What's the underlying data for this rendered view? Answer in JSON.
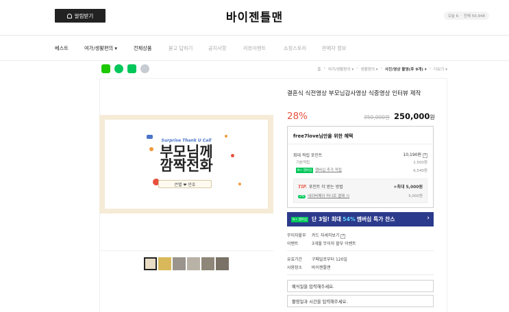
{
  "header": {
    "notify_label": "알림받기",
    "shop_title": "바이젠틀맨",
    "visitor_today": "오늘 6",
    "visitor_total": "전체 50,948"
  },
  "nav": {
    "items": [
      {
        "label": "베스트"
      },
      {
        "label": "여가/생활편의 ▾"
      },
      {
        "label": "전체상품"
      },
      {
        "label": "묻고 답하기"
      },
      {
        "label": "공지사항"
      },
      {
        "label": "리뷰이벤트"
      },
      {
        "label": "쇼핑스토리"
      },
      {
        "label": "판매자 정보"
      }
    ]
  },
  "breadcrumb": {
    "items": [
      "홈",
      "여가/생활편의 ▾",
      "생활편의 ▾",
      "사진/영상 촬영(후 9개) ▾",
      "더보기 ▾"
    ]
  },
  "hero": {
    "sub": "Surprise Thank U Call",
    "title_line1": "부모님께",
    "title_line2": "깜짝전화",
    "chip": "은별 ❤ 민호"
  },
  "product": {
    "name": "결혼식 식전영상 부모님감사영상 식중영상 인터뷰 제작",
    "discount": "28%",
    "original_price": "350,000원",
    "price": "250,000",
    "price_unit": "원"
  },
  "benefit": {
    "heading": "free7love님만을 위한 혜택",
    "max_points_label": "최대 적립 포인트",
    "max_points_value": "10,190원",
    "basic_label": "기본적립",
    "basic_value": "2,500원",
    "member_badge": "N+ 멤버십",
    "member_label": "멤버십 추가 적립",
    "member_value": "6,540원",
    "tip_label": "TIP.",
    "tip_text": "포인트 더 받는 방법",
    "tip_value": "+최대 5,000원",
    "pct_badge": "2%",
    "pay_text": "네이버페이 머니로 결제 시",
    "pay_value": "5,000원"
  },
  "banner": {
    "badge": "N+ 멤버십",
    "text_pre": "단 3일! 최대",
    "text_hl": "54%",
    "text_post": "멤버십 특가 찬스",
    "arrow": "›"
  },
  "info": {
    "installment_key": "무이자할부",
    "installment_val": "카드 자세히보기",
    "event_key": "이벤트",
    "event_val": "3개월 무이자 할부 이벤트",
    "validity_key": "유효기간",
    "validity_val": "구매일로부터 120일",
    "place_key": "사용장소",
    "place_val": "바이젠틀맨"
  },
  "inputs": {
    "wedding_date": "예식일을 입력해주세요.",
    "shoot_time": "촬영일과 시간을 입력해주세요."
  }
}
